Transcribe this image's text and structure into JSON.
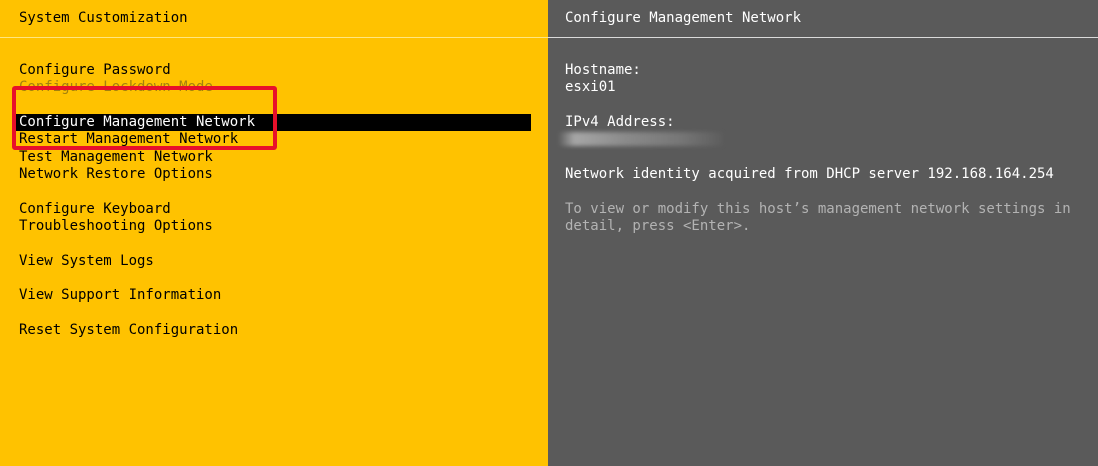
{
  "left_pane": {
    "title": "System Customization",
    "menu": [
      {
        "label": "Configure Password"
      },
      {
        "label": "Configure Lockdown Mode"
      },
      {
        "label": "Configure Management Network"
      },
      {
        "label": "Restart Management Network"
      },
      {
        "label": "Test Management Network"
      },
      {
        "label": "Network Restore Options"
      },
      {
        "label": "Configure Keyboard"
      },
      {
        "label": "Troubleshooting Options"
      },
      {
        "label": "View System Logs"
      },
      {
        "label": "View Support Information"
      },
      {
        "label": "Reset System Configuration"
      }
    ],
    "selected_label": "Configure Management Network"
  },
  "right_pane": {
    "title": "Configure Management Network",
    "hostname_label": "Hostname:",
    "hostname_value": "esxi01",
    "ipv4_label": "IPv4 Address:",
    "network_identity": "Network identity acquired from DHCP server 192.168.164.254",
    "help_text": "To view or modify this host’s management network settings in detail, press <Enter>."
  },
  "colors": {
    "left_background": "#FFC200",
    "right_background": "#5A5A5A",
    "selection_background": "#000000",
    "annotation_box": "#E8102A"
  }
}
